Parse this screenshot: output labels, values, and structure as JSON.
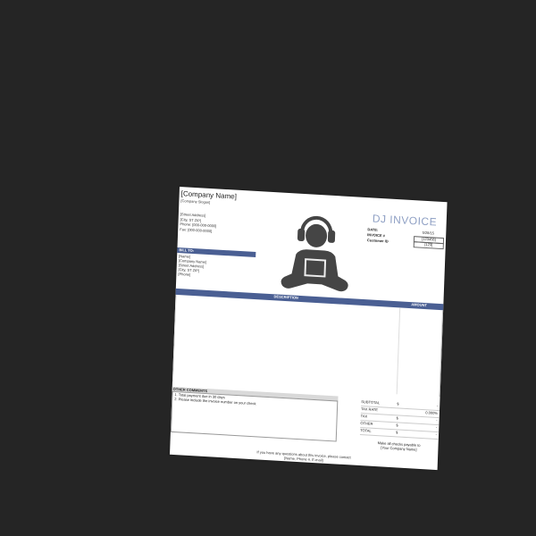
{
  "company": {
    "name": "[Company Name]",
    "slogan": "[Company Slogan]",
    "address_lines": [
      "[Street Address]",
      "[City, ST  ZIP]",
      "Phone: [000-000-0000]",
      "Fax: [000-000-0000]"
    ]
  },
  "invoice": {
    "title": "DJ INVOICE",
    "date_label": "DATE:",
    "date_value": "5/28/15",
    "invoice_label": "INVOICE #",
    "invoice_value": "[123456]",
    "customer_label": "Customer ID",
    "customer_value": "[123]"
  },
  "bill_to": {
    "header": "BILL TO:",
    "lines": [
      "[Name]",
      "[Company Name]",
      "[Street Address]",
      "[City, ST  ZIP]",
      "[Phone]"
    ]
  },
  "table": {
    "description_header": "DESCRIPTION",
    "amount_header": "AMOUNT"
  },
  "comments": {
    "header": "OTHER COMMENTS",
    "lines": [
      "1. Total payment due in 30 days",
      "2. Please include the invoice number on your check"
    ]
  },
  "totals": {
    "rows": [
      {
        "label": "SUBTOTAL",
        "symbol": "$",
        "value": "-"
      },
      {
        "label": "TAX RATE",
        "symbol": "",
        "value": "0.000%"
      },
      {
        "label": "TAX",
        "symbol": "$",
        "value": "-"
      },
      {
        "label": "OTHER",
        "symbol": "$",
        "value": "-"
      },
      {
        "label": "TOTAL",
        "symbol": "$",
        "value": "-"
      }
    ]
  },
  "payable": {
    "line1": "Make all checks payable to",
    "line2": "[Your Company Name]"
  },
  "footer": {
    "line1": "If you have any questions about this invoice, please contact",
    "line2": "[Name, Phone #, E-mail]"
  },
  "colors": {
    "background": "#252525",
    "accent": "#4a5f93",
    "title": "#8fa0c4",
    "icon": "#454545"
  }
}
